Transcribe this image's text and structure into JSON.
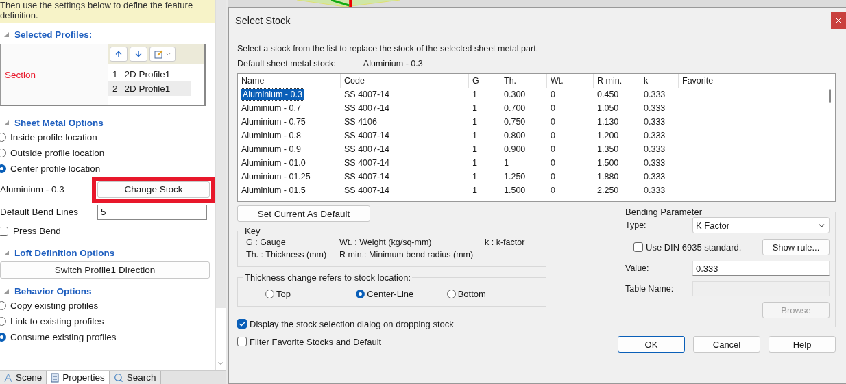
{
  "left_panel": {
    "hint_lines": [
      "Then use the settings below to define the feature",
      "definition."
    ],
    "selected_profiles": {
      "title": "Selected Profiles:",
      "section_label": "Section",
      "items": [
        {
          "index": "1",
          "name": "2D Profile1",
          "selected": false
        },
        {
          "index": "2",
          "name": "2D Profile1",
          "selected": true
        }
      ]
    },
    "sheet_metal": {
      "title": "Sheet Metal Options",
      "options": [
        {
          "label": "Inside profile location",
          "selected": false
        },
        {
          "label": "Outside profile location",
          "selected": false
        },
        {
          "label": "Center profile location",
          "selected": true
        }
      ],
      "stock_label": "Aluminium - 0.3",
      "change_stock_button": "Change Stock",
      "bend_lines_label": "Default Bend Lines",
      "bend_lines_value": "5",
      "press_bend": {
        "label": "Press Bend",
        "checked": false
      }
    },
    "loft": {
      "title": "Loft Definition Options",
      "button": "Switch Profile1 Direction"
    },
    "behavior": {
      "title": "Behavior Options",
      "options": [
        {
          "label": "Copy existing profiles",
          "selected": false
        },
        {
          "label": "Link to existing profiles",
          "selected": false
        },
        {
          "label": "Consume existing profiles",
          "selected": true
        }
      ]
    },
    "tabs": [
      {
        "label": "Scene",
        "selected": false
      },
      {
        "label": "Properties",
        "selected": true
      },
      {
        "label": "Search",
        "selected": false
      }
    ]
  },
  "dialog": {
    "title": "Select Stock",
    "description": "Select a stock from the list to replace the stock of the selected sheet metal part.",
    "default_label": "Default sheet metal stock:",
    "default_value": "Aluminium - 0.3",
    "table": {
      "columns": [
        "Name",
        "Code",
        "G",
        "Th.",
        "Wt.",
        "R min.",
        "k",
        "Favorite"
      ],
      "rows": [
        {
          "cells": [
            "Aluminium - 0.3",
            "SS 4007-14",
            "1",
            "0.300",
            "0",
            "0.450",
            "0.333"
          ],
          "selected": true
        },
        {
          "cells": [
            "Aluminium - 0.7",
            "SS 4007-14",
            "1",
            "0.700",
            "0",
            "1.050",
            "0.333"
          ],
          "selected": false
        },
        {
          "cells": [
            "Aluminium - 0.75",
            "SS 4106",
            "1",
            "0.750",
            "0",
            "1.130",
            "0.333"
          ],
          "selected": false
        },
        {
          "cells": [
            "Aluminium - 0.8",
            "SS 4007-14",
            "1",
            "0.800",
            "0",
            "1.200",
            "0.333"
          ],
          "selected": false
        },
        {
          "cells": [
            "Aluminium - 0.9",
            "SS 4007-14",
            "1",
            "0.900",
            "0",
            "1.350",
            "0.333"
          ],
          "selected": false
        },
        {
          "cells": [
            "Aluminium - 01.0",
            "SS 4007-14",
            "1",
            "1",
            "0",
            "1.500",
            "0.333"
          ],
          "selected": false
        },
        {
          "cells": [
            "Aluminium - 01.25",
            "SS 4007-14",
            "1",
            "1.250",
            "0",
            "1.880",
            "0.333"
          ],
          "selected": false
        },
        {
          "cells": [
            "Aluminium - 01.5",
            "SS 4007-14",
            "1",
            "1.500",
            "0",
            "2.250",
            "0.333"
          ],
          "selected": false
        }
      ]
    },
    "set_default_button": "Set Current As Default",
    "key": {
      "title": "Key",
      "items": [
        "G : Gauge",
        "Wt. : Weight (kg/sq-mm)",
        "k : k-factor",
        "Th. : Thickness (mm)",
        "R min.: Minimum bend radius (mm)"
      ]
    },
    "thickness": {
      "title": "Thickness change refers to stock location:",
      "options": [
        {
          "label": "Top",
          "selected": false
        },
        {
          "label": "Center-Line",
          "selected": true
        },
        {
          "label": "Bottom",
          "selected": false
        }
      ]
    },
    "checkboxes": [
      {
        "label": "Display the stock selection dialog on dropping stock",
        "checked": true
      },
      {
        "label": "Filter Favorite Stocks and Default",
        "checked": false
      }
    ],
    "bending": {
      "title": "Bending Parameter",
      "type_label": "Type:",
      "type_value": "K Factor",
      "din": {
        "label": "Use DIN 6935 standard.",
        "checked": false
      },
      "show_rule_button": "Show rule...",
      "value_label": "Value:",
      "value": "0.333",
      "table_name_label": "Table Name:",
      "browse_button": {
        "label": "Browse",
        "disabled": true
      }
    },
    "buttons": [
      {
        "label": "OK",
        "focused": true
      },
      {
        "label": "Cancel",
        "focused": false
      },
      {
        "label": "Help",
        "focused": false
      }
    ]
  }
}
